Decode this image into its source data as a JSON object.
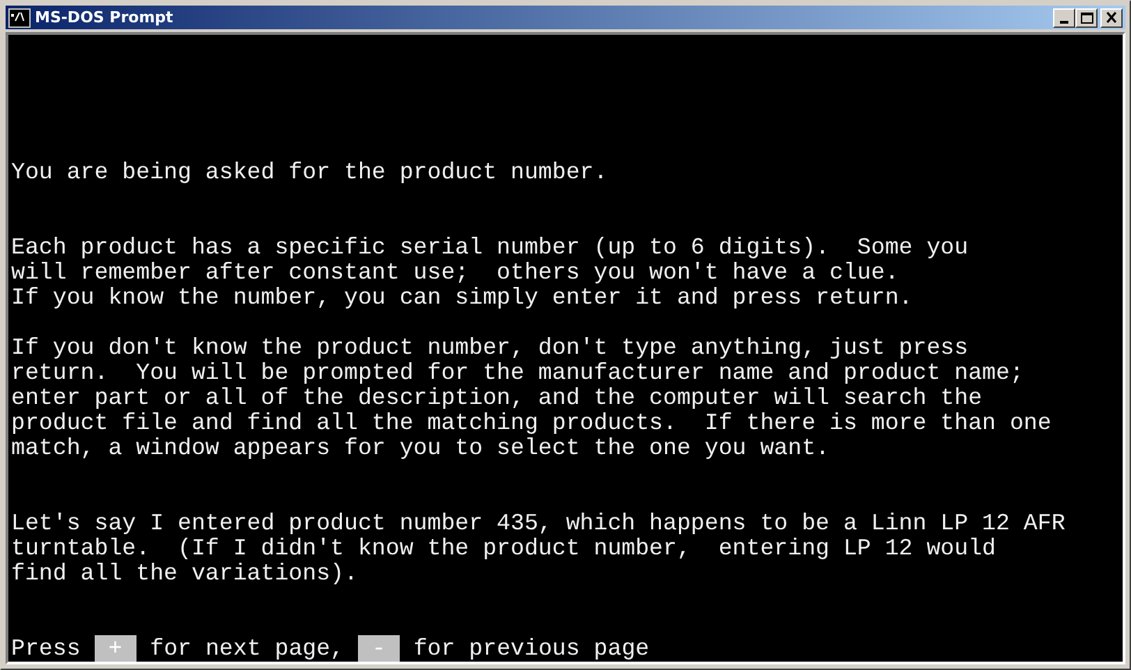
{
  "window": {
    "title": "MS-DOS Prompt"
  },
  "paragraphs": [
    [
      "You are being asked for the product number."
    ],
    [
      "Each product has a specific serial number (up to 6 digits).  Some you",
      "will remember after constant use;  others you won't have a clue.",
      "If you know the number, you can simply enter it and press return."
    ],
    [
      "If you don't know the product number, don't type anything, just press",
      "return.  You will be prompted for the manufacturer name and product name;",
      "enter part or all of the description, and the computer will search the",
      "product file and find all the matching products.  If there is more than one",
      "match, a window appears for you to select the one you want."
    ],
    [
      "Let's say I entered product number 435, which happens to be a Linn LP 12 AFR",
      "turntable.  (If I didn't know the product number,  entering LP 12 would",
      "find all the variations)."
    ]
  ],
  "prompt": {
    "prefix": "Press",
    "keys": [
      {
        "label": "+",
        "action": "for next page,"
      },
      {
        "label": "-",
        "action": "for previous page"
      }
    ]
  }
}
